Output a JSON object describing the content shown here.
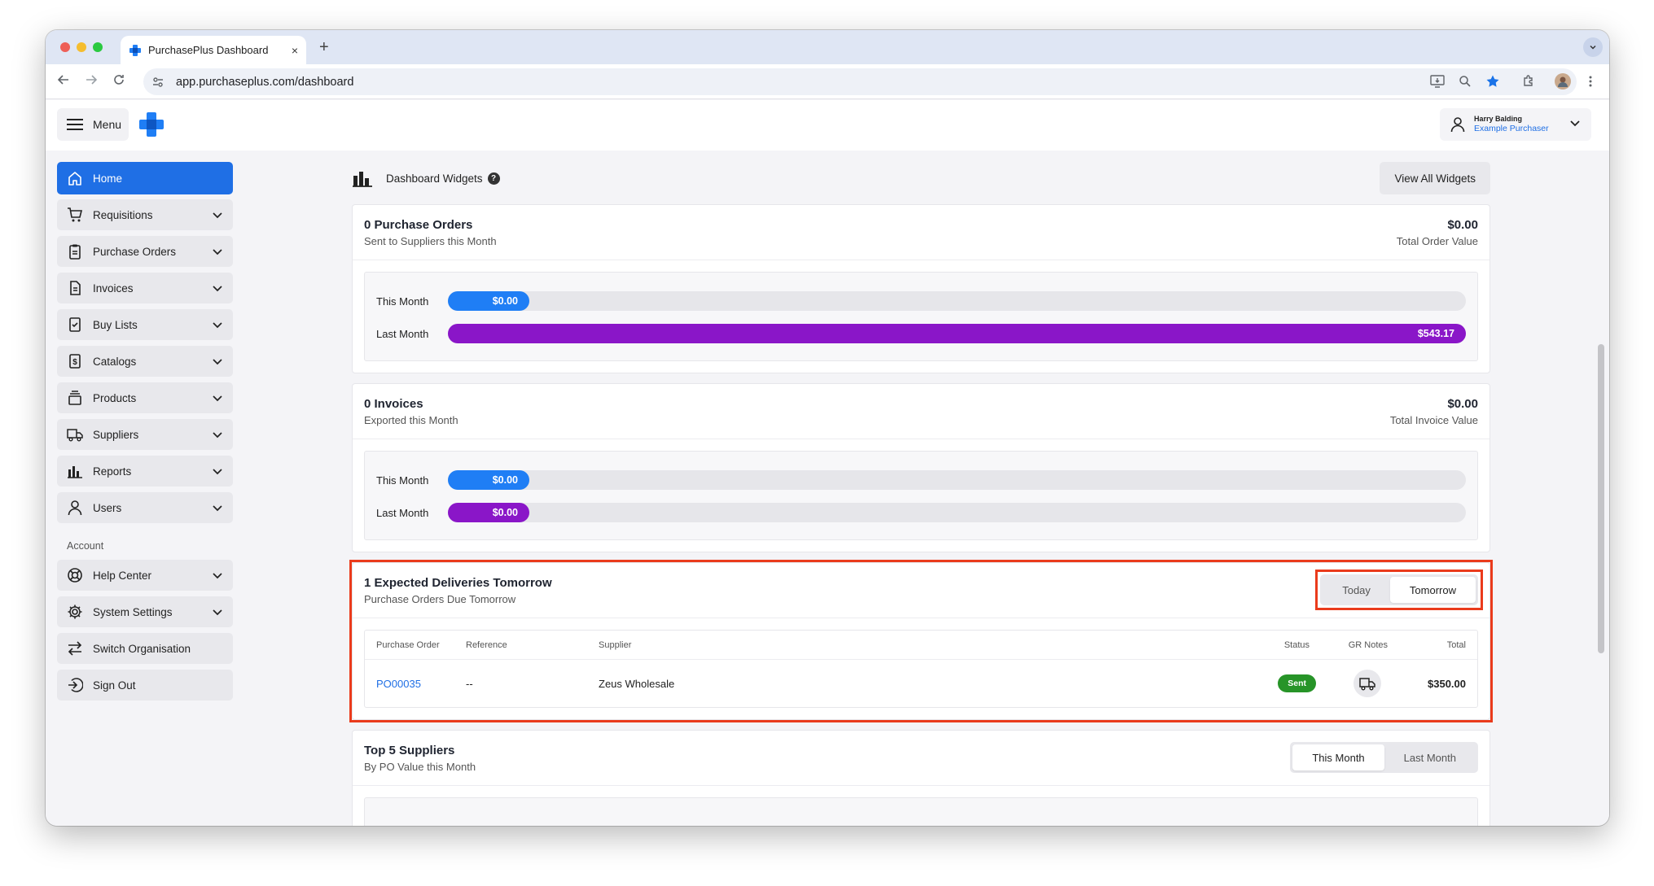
{
  "browser": {
    "tab_title": "PurchasePlus Dashboard",
    "tab_close": "×",
    "new_tab": "+",
    "url": "app.purchaseplus.com/dashboard"
  },
  "header": {
    "menu_label": "Menu",
    "user_name": "Harry Balding",
    "user_org": "Example Purchaser"
  },
  "sidebar": {
    "items": [
      {
        "label": "Home",
        "icon": "home-icon"
      },
      {
        "label": "Requisitions",
        "icon": "cart-icon"
      },
      {
        "label": "Purchase Orders",
        "icon": "clipboard-icon"
      },
      {
        "label": "Invoices",
        "icon": "document-icon"
      },
      {
        "label": "Buy Lists",
        "icon": "checklist-icon"
      },
      {
        "label": "Catalogs",
        "icon": "dollar-icon"
      },
      {
        "label": "Products",
        "icon": "box-icon"
      },
      {
        "label": "Suppliers",
        "icon": "truck-icon"
      },
      {
        "label": "Reports",
        "icon": "bar-chart-icon"
      },
      {
        "label": "Users",
        "icon": "user-icon"
      }
    ],
    "account_heading": "Account",
    "account_items": [
      {
        "label": "Help Center",
        "icon": "lifebuoy-icon"
      },
      {
        "label": "System Settings",
        "icon": "gear-icon"
      },
      {
        "label": "Switch Organisation",
        "icon": "switch-arrows-icon"
      },
      {
        "label": "Sign Out",
        "icon": "sign-out-icon"
      }
    ]
  },
  "main": {
    "widgets_title": "Dashboard Widgets",
    "help_glyph": "?",
    "view_all_label": "View All Widgets",
    "po_card": {
      "title": "0 Purchase Orders",
      "subtitle": "Sent to Suppliers this Month",
      "amount": "$0.00",
      "amount_label": "Total Order Value",
      "this_month_label": "This Month",
      "this_month_value": "$0.00",
      "this_month_fraction": 0.0,
      "last_month_label": "Last Month",
      "last_month_value": "$543.17",
      "last_month_fraction": 1.0
    },
    "invoice_card": {
      "title": "0 Invoices",
      "subtitle": "Exported this Month",
      "amount": "$0.00",
      "amount_label": "Total Invoice Value",
      "this_month_label": "This Month",
      "this_month_value": "$0.00",
      "this_month_fraction": 0.0,
      "last_month_label": "Last Month",
      "last_month_value": "$0.00",
      "last_month_fraction": 0.0
    },
    "deliveries_card": {
      "title": "1 Expected Deliveries Tomorrow",
      "subtitle": "Purchase Orders Due Tomorrow",
      "toggle_today": "Today",
      "toggle_tomorrow": "Tomorrow",
      "selected": "Tomorrow",
      "columns": {
        "purchase_order": "Purchase Order",
        "reference": "Reference",
        "supplier": "Supplier",
        "status": "Status",
        "gr_notes": "GR Notes",
        "total": "Total"
      },
      "rows": [
        {
          "purchase_order": "PO00035",
          "reference": "--",
          "supplier": "Zeus Wholesale",
          "status": "Sent",
          "total": "$350.00"
        }
      ]
    },
    "suppliers_card": {
      "title": "Top 5 Suppliers",
      "subtitle": "By PO Value this Month",
      "toggle_this_month": "This Month",
      "toggle_last_month": "Last Month",
      "selected": "This Month"
    }
  },
  "colors": {
    "accent_blue": "#1f6fe5",
    "bar_blue": "#1f7ef5",
    "bar_purple": "#8a16c8",
    "status_green": "#279428",
    "highlight_red": "#ea3b1c"
  }
}
